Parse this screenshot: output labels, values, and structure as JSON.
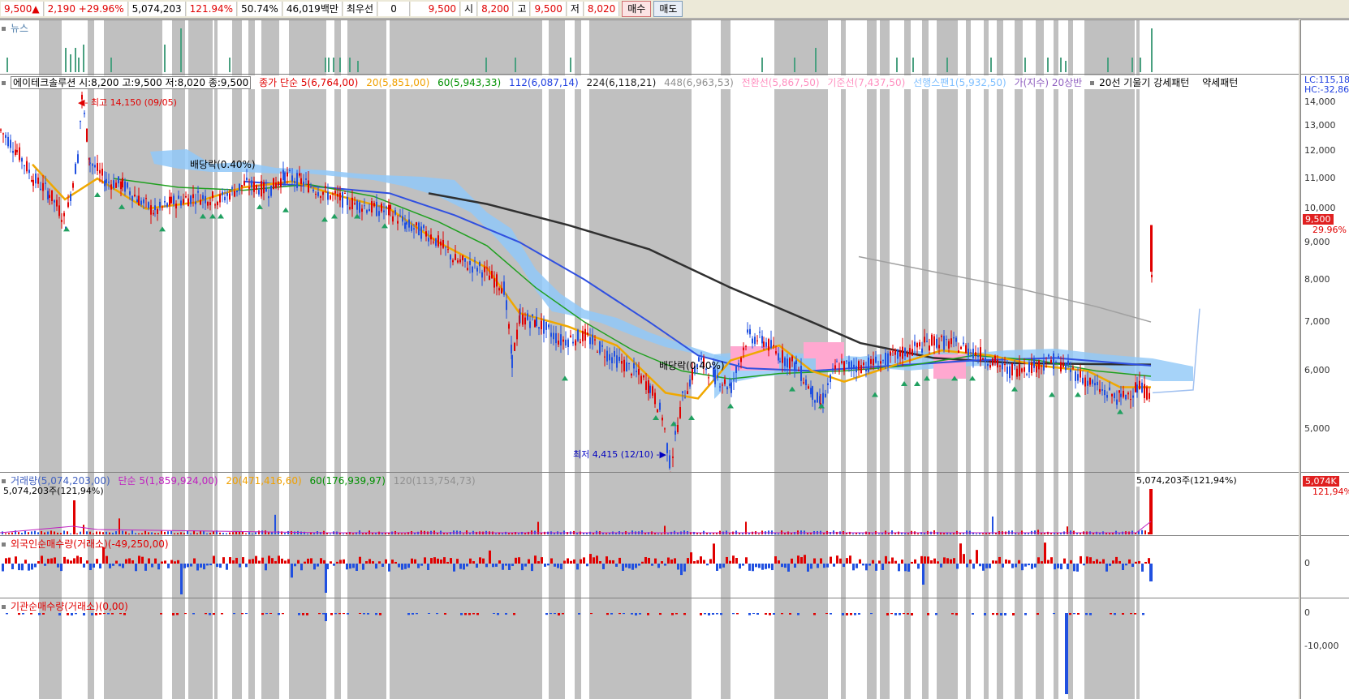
{
  "topbar": {
    "price": "9,500",
    "up_arrow": "▲",
    "change": "2,190",
    "change_pct": "+29.96%",
    "volume": "5,074,203",
    "vol_ratio": "121.94%",
    "turnover": "50.74%",
    "amount": "46,019백만",
    "best_ask_label": "최우선",
    "best_ask_qty": "0",
    "best_ask_price": "9,500",
    "open_label": "시",
    "open": "8,200",
    "high_label": "고",
    "high": "9,500",
    "low_label": "저",
    "low": "8,020",
    "buy_label": "매수",
    "sell_label": "매도"
  },
  "news_panel": {
    "title": "뉴스"
  },
  "price_panel": {
    "title": "에이테크솔루션 시:8,200 고:9,500 저:8,020 종:9,500",
    "ma_label": "종가 단순 5(6,764,00)",
    "ma20": "20(5,851,00)",
    "ma60": "60(5,943,33)",
    "ma112": "112(6,087,14)",
    "ma224": "224(6,118,21)",
    "ma448": "448(6,963,53)",
    "ichimoku_a": "전환선(5,867,50)",
    "ichimoku_b": "기준선(7,437,50)",
    "span": "선행스팬1(5,932,50)",
    "trend": "가(지수) 20상반",
    "pattern1": "20선 기울기 강세패턴",
    "pattern2": "약세패턴",
    "high_note": "최고 14,150 (09/05)",
    "low_note": "최저 4,415 (12/10)",
    "div1": "배당락(0.40%)",
    "div2": "배당락(0.40%)",
    "lc": "LC:115,18",
    "hc": "HC:-32,86",
    "ticks": [
      "14,000",
      "13,000",
      "12,000",
      "11,000",
      "10,000",
      "9,000",
      "8,000",
      "7,000",
      "6,000",
      "5,000"
    ],
    "current_box": "9,500",
    "current_pct": "29.96%"
  },
  "volume_panel": {
    "title": "거래량(5,074,203,00)",
    "ma5": "단순 5(1,859,924,00)",
    "ma20": "20(471,416,60)",
    "ma60": "60(176,939,97)",
    "ma120": "120(113,754,73)",
    "sub": "5,074,203주(121,94%)",
    "right_note": "5,074,203주(121,94%)",
    "box": "5,074K",
    "box_pct": "121,94%"
  },
  "foreign_panel": {
    "title": "외국인순매수량(거래소)(-49,250,00)",
    "tick": "0"
  },
  "inst_panel": {
    "title": "기관순매수량(거래소)(0,00)",
    "tick0": "0",
    "tick1": "-10,000"
  },
  "chart_data": {
    "type": "candlestick",
    "price_axis": [
      4500,
      14500
    ],
    "close_path_points": [
      [
        0,
        12800
      ],
      [
        20,
        12000
      ],
      [
        40,
        11000
      ],
      [
        60,
        10500
      ],
      [
        80,
        9600
      ],
      [
        95,
        11800
      ],
      [
        100,
        14150
      ],
      [
        110,
        11600
      ],
      [
        130,
        10900
      ],
      [
        150,
        10800
      ],
      [
        170,
        10300
      ],
      [
        190,
        9900
      ],
      [
        210,
        10200
      ],
      [
        240,
        10400
      ],
      [
        270,
        10300
      ],
      [
        300,
        10800
      ],
      [
        330,
        10600
      ],
      [
        350,
        11100
      ],
      [
        370,
        10900
      ],
      [
        400,
        10500
      ],
      [
        430,
        10200
      ],
      [
        460,
        10000
      ],
      [
        480,
        9900
      ],
      [
        500,
        9500
      ],
      [
        530,
        9200
      ],
      [
        560,
        8500
      ],
      [
        590,
        8300
      ],
      [
        620,
        7800
      ],
      [
        630,
        6200
      ],
      [
        640,
        7100
      ],
      [
        660,
        7000
      ],
      [
        690,
        6600
      ],
      [
        720,
        6700
      ],
      [
        750,
        6300
      ],
      [
        780,
        6000
      ],
      [
        800,
        5700
      ],
      [
        815,
        5200
      ],
      [
        825,
        4415
      ],
      [
        840,
        5500
      ],
      [
        860,
        6200
      ],
      [
        880,
        5900
      ],
      [
        900,
        5700
      ],
      [
        920,
        6700
      ],
      [
        940,
        6600
      ],
      [
        960,
        6300
      ],
      [
        980,
        6100
      ],
      [
        1000,
        5600
      ],
      [
        1010,
        5400
      ],
      [
        1030,
        6100
      ],
      [
        1060,
        6100
      ],
      [
        1090,
        6200
      ],
      [
        1120,
        6400
      ],
      [
        1150,
        6600
      ],
      [
        1180,
        6500
      ],
      [
        1210,
        6300
      ],
      [
        1240,
        6000
      ],
      [
        1270,
        6100
      ],
      [
        1300,
        6200
      ],
      [
        1330,
        5900
      ],
      [
        1360,
        5600
      ],
      [
        1380,
        5500
      ],
      [
        1400,
        5700
      ],
      [
        1415,
        5600
      ],
      [
        1420,
        9500
      ]
    ]
  }
}
